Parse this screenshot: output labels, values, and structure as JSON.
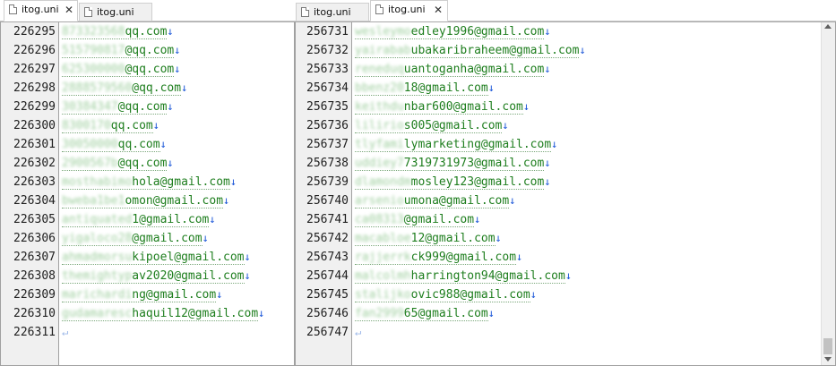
{
  "left": {
    "tabs": [
      {
        "label": "itog.uni",
        "active": true,
        "closable": true
      },
      {
        "label": "itog.uni",
        "active": false,
        "closable": false
      }
    ],
    "lines": [
      {
        "num": "226295",
        "masked": "873323568",
        "visible": "qq.com"
      },
      {
        "num": "226296",
        "masked": "515790817",
        "visible": "@qq.com"
      },
      {
        "num": "226297",
        "masked": "625300000",
        "visible": "@qq.com"
      },
      {
        "num": "226298",
        "masked": "2888579560",
        "visible": "@qq.com"
      },
      {
        "num": "226299",
        "masked": "30384347",
        "visible": "@qq.com"
      },
      {
        "num": "226300",
        "masked": "8300170",
        "visible": "qq.com"
      },
      {
        "num": "226301",
        "masked": "30050000",
        "visible": "qq.com"
      },
      {
        "num": "226302",
        "masked": "2900567b",
        "visible": "@qq.com"
      },
      {
        "num": "226303",
        "masked": "mosthabimo",
        "visible": "hola@gmail.com"
      },
      {
        "num": "226304",
        "masked": "bweba1be1",
        "visible": "omon@gmail.com"
      },
      {
        "num": "226305",
        "masked": "antiquated",
        "visible": "1@gmail.com"
      },
      {
        "num": "226306",
        "masked": "yigaloco28",
        "visible": "@gmail.com"
      },
      {
        "num": "226307",
        "masked": "ahmadmorsu",
        "visible": "kipoel@gmail.com"
      },
      {
        "num": "226308",
        "masked": "themightyp",
        "visible": "av2020@gmail.com"
      },
      {
        "num": "226309",
        "masked": "marichardi",
        "visible": "ng@gmail.com"
      },
      {
        "num": "226310",
        "masked": "gudamaresc",
        "visible": "haquil12@gmail.com"
      },
      {
        "num": "226311",
        "masked": "",
        "visible": "",
        "eof": true
      }
    ]
  },
  "right": {
    "tabs": [
      {
        "label": "itog.uni",
        "active": false,
        "closable": false
      },
      {
        "label": "itog.uni",
        "active": true,
        "closable": true
      }
    ],
    "lines": [
      {
        "num": "256731",
        "masked": "wesleymo",
        "visible": "edley1996@gmail.com"
      },
      {
        "num": "256732",
        "masked": "yairabab",
        "visible": "ubakaribraheem@gmail.com"
      },
      {
        "num": "256733",
        "masked": "reneduq",
        "visible": "uantoganha@gmail.com"
      },
      {
        "num": "256734",
        "masked": "bbenz20",
        "visible": "18@gmail.com"
      },
      {
        "num": "256735",
        "masked": "keithdu",
        "visible": "nbar600@gmail.com"
      },
      {
        "num": "256736",
        "masked": "lilirio",
        "visible": "s005@gmail.com"
      },
      {
        "num": "256737",
        "masked": "tlyfami",
        "visible": "lymarketing@gmail.com"
      },
      {
        "num": "256738",
        "masked": "uddiey7",
        "visible": "7319731973@gmail.com"
      },
      {
        "num": "256739",
        "masked": "dlamondm",
        "visible": "mosley123@gmail.com"
      },
      {
        "num": "256740",
        "masked": "arsenio",
        "visible": "umona@gmail.com"
      },
      {
        "num": "256741",
        "masked": "ca08313",
        "visible": "@gmail.com"
      },
      {
        "num": "256742",
        "masked": "macabloe",
        "visible": "12@gmail.com"
      },
      {
        "num": "256743",
        "masked": "rajjerrk",
        "visible": "ck999@gmail.com"
      },
      {
        "num": "256744",
        "masked": "malcolmh",
        "visible": "harrington94@gmail.com"
      },
      {
        "num": "256745",
        "masked": "stalijko",
        "visible": "ovic988@gmail.com"
      },
      {
        "num": "256746",
        "masked": "fan2999",
        "visible": "65@gmail.com"
      },
      {
        "num": "256747",
        "masked": "",
        "visible": "",
        "eof": true
      }
    ]
  },
  "symbols": {
    "line_end": "↓",
    "eof": "↵",
    "close": "✕"
  },
  "colors": {
    "text": "#1e7e1e",
    "line_end_arrow": "#1a55d8",
    "gutter_bg": "#f0f0f0"
  },
  "icons": {
    "tab": "document-icon",
    "close": "close-icon"
  }
}
